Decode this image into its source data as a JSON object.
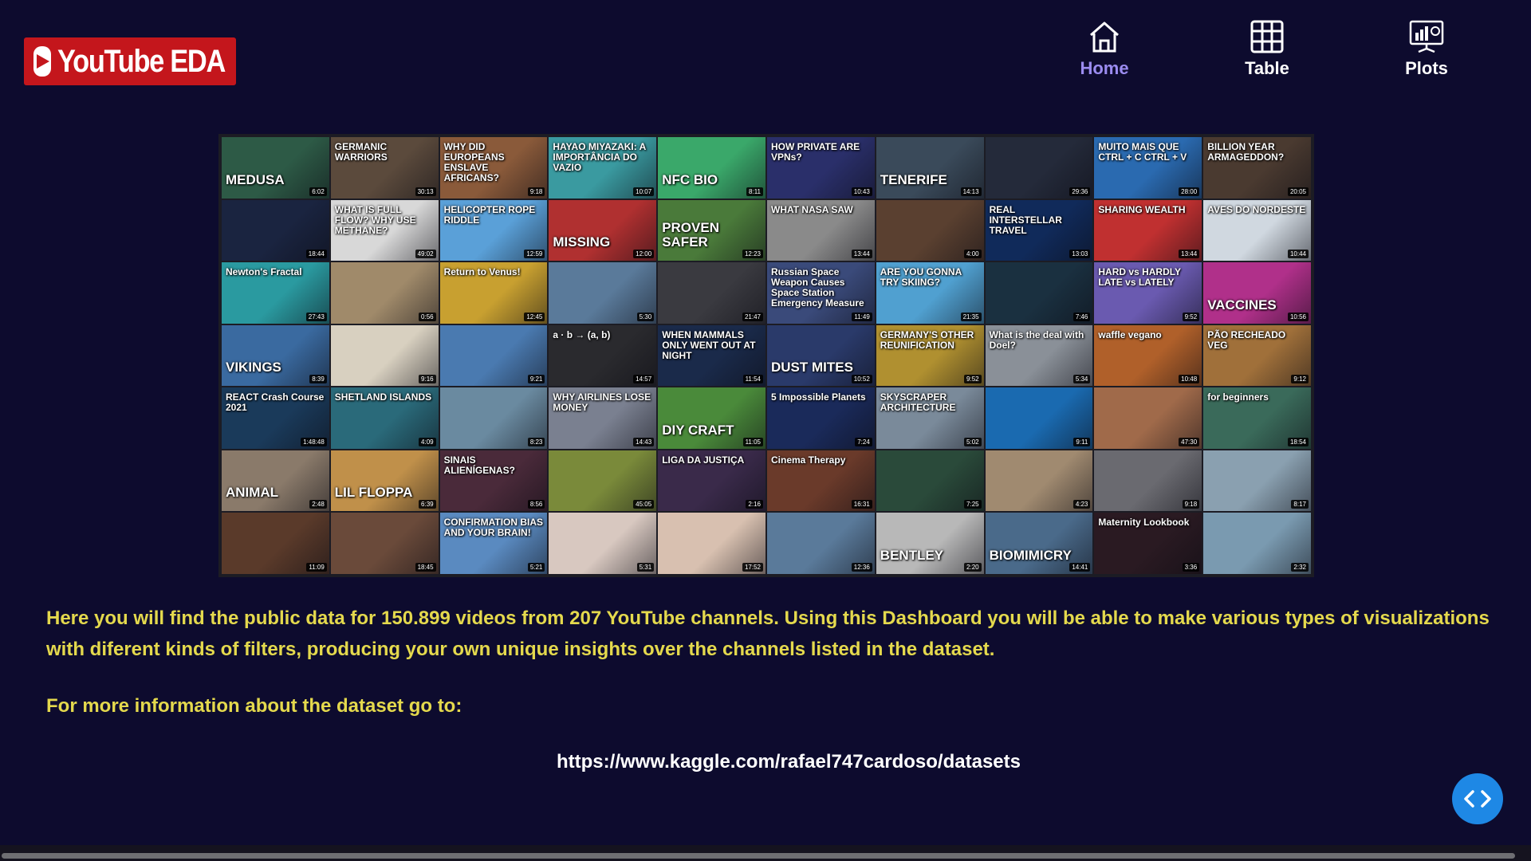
{
  "brand": {
    "name": "YouTube EDA",
    "logo_color": "#c4161c"
  },
  "nav": {
    "items": [
      {
        "label": "Home",
        "icon": "home-icon",
        "active": true
      },
      {
        "label": "Table",
        "icon": "table-icon",
        "active": false
      },
      {
        "label": "Plots",
        "icon": "plots-icon",
        "active": false
      }
    ]
  },
  "mosaic": {
    "thumbnails": [
      {
        "title": "MEDUSA",
        "duration": "6:02",
        "color": "#2d5a46"
      },
      {
        "title": "GERMANIC WARRIORS",
        "duration": "30:13",
        "color": "#5b4a3c"
      },
      {
        "title": "WHY DID EUROPEANS ENSLAVE AFRICANS?",
        "duration": "9:18",
        "color": "#8a5a3a"
      },
      {
        "title": "HAYAO MIYAZAKI: A IMPORTÂNCIA DO VAZIO",
        "duration": "10:07",
        "color": "#3a9aa0"
      },
      {
        "title": "NFC BIO",
        "duration": "8:11",
        "color": "#3aa86a"
      },
      {
        "title": "HOW PRIVATE ARE VPNs?",
        "duration": "10:43",
        "color": "#2a2f6a"
      },
      {
        "title": "TENERIFE",
        "duration": "14:13",
        "color": "#3a4a5a"
      },
      {
        "title": "",
        "duration": "29:36",
        "color": "#242a3a"
      },
      {
        "title": "MUITO MAIS QUE CTRL + C CTRL + V",
        "duration": "28:00",
        "color": "#2a6ab0"
      },
      {
        "title": "BILLION YEAR ARMAGEDDON?",
        "duration": "20:05",
        "color": "#4a3a30"
      },
      {
        "title": "",
        "duration": "18:44",
        "color": "#1a2440"
      },
      {
        "title": "WHAT IS FULL FLOW? WHY USE METHANE?",
        "duration": "49:02",
        "color": "#d8d8d8"
      },
      {
        "title": "HELICOPTER ROPE RIDDLE",
        "duration": "12:59",
        "color": "#5aa0d8"
      },
      {
        "title": "MISSING",
        "duration": "12:00",
        "color": "#b03030"
      },
      {
        "title": "PROVEN SAFER",
        "duration": "12:23",
        "color": "#4a7a3a"
      },
      {
        "title": "WHAT NASA SAW",
        "duration": "13:44",
        "color": "#8a8a8a"
      },
      {
        "title": "",
        "duration": "4:00",
        "color": "#5a4030"
      },
      {
        "title": "REAL INTERSTELLAR TRAVEL",
        "duration": "13:03",
        "color": "#102a5a"
      },
      {
        "title": "SHARING WEALTH",
        "duration": "13:44",
        "color": "#c03030"
      },
      {
        "title": "AVES DO NORDESTE",
        "duration": "10:44",
        "color": "#d0d8e0"
      },
      {
        "title": "Newton's Fractal",
        "duration": "27:43",
        "color": "#2a9aa0"
      },
      {
        "title": "",
        "duration": "0:56",
        "color": "#a08a6a"
      },
      {
        "title": "Return to Venus!",
        "duration": "12:45",
        "color": "#c8a030"
      },
      {
        "title": "",
        "duration": "5:30",
        "color": "#5a7a9a"
      },
      {
        "title": "",
        "duration": "21:47",
        "color": "#3a3a40"
      },
      {
        "title": "Russian Space Weapon Causes Space Station Emergency Measure",
        "duration": "11:49",
        "color": "#3a4a7a"
      },
      {
        "title": "ARE YOU GONNA TRY SKIING?",
        "duration": "21:35",
        "color": "#50a0d0"
      },
      {
        "title": "",
        "duration": "7:46",
        "color": "#1a3040"
      },
      {
        "title": "HARD vs HARDLY LATE vs LATELY",
        "duration": "9:52",
        "color": "#6a5ab0"
      },
      {
        "title": "VACCINES",
        "duration": "10:56",
        "color": "#b0308a"
      },
      {
        "title": "VIKINGS",
        "duration": "8:39",
        "color": "#3a6aa0"
      },
      {
        "title": "",
        "duration": "9:16",
        "color": "#d8d0c0"
      },
      {
        "title": "",
        "duration": "9:21",
        "color": "#4a7ab0"
      },
      {
        "title": "a · b → (a, b)",
        "duration": "14:57",
        "color": "#2a2a2e"
      },
      {
        "title": "WHEN MAMMALS ONLY WENT OUT AT NIGHT",
        "duration": "11:54",
        "color": "#1a2a4a"
      },
      {
        "title": "DUST MITES",
        "duration": "10:52",
        "color": "#2a3a6a"
      },
      {
        "title": "GERMANY'S OTHER REUNIFICATION",
        "duration": "9:52",
        "color": "#b09030"
      },
      {
        "title": "What is the deal with Doel?",
        "duration": "5:34",
        "color": "#8a9098"
      },
      {
        "title": "waffle vegano",
        "duration": "10:48",
        "color": "#b0602a"
      },
      {
        "title": "PÃO RECHEADO VEG",
        "duration": "9:12",
        "color": "#a0703a"
      },
      {
        "title": "REACT Crash Course 2021",
        "duration": "1:48:48",
        "color": "#1a3a5a"
      },
      {
        "title": "SHETLAND ISLANDS",
        "duration": "4:09",
        "color": "#2a6a7a"
      },
      {
        "title": "",
        "duration": "8:23",
        "color": "#6a8aa0"
      },
      {
        "title": "WHY AIRLINES LOSE MONEY",
        "duration": "14:43",
        "color": "#7a8090"
      },
      {
        "title": "DIY CRAFT",
        "duration": "11:05",
        "color": "#4a8a3a"
      },
      {
        "title": "5 Impossible Planets",
        "duration": "7:24",
        "color": "#1a2a5a"
      },
      {
        "title": "SKYSCRAPER ARCHITECTURE",
        "duration": "5:02",
        "color": "#7a8a9a"
      },
      {
        "title": "",
        "duration": "9:11",
        "color": "#1a6ab0"
      },
      {
        "title": "",
        "duration": "47:30",
        "color": "#a06a4a"
      },
      {
        "title": "for beginners",
        "duration": "18:54",
        "color": "#3a6a5a"
      },
      {
        "title": "ANIMAL",
        "duration": "2:48",
        "color": "#8a7a6a"
      },
      {
        "title": "LIL FLOPPA",
        "duration": "6:39",
        "color": "#c0904a"
      },
      {
        "title": "SINAIS ALIENÍGENAS?",
        "duration": "8:56",
        "color": "#4a2a3a"
      },
      {
        "title": "",
        "duration": "45:05",
        "color": "#7a8a3a"
      },
      {
        "title": "LIGA DA JUSTIÇA",
        "duration": "2:16",
        "color": "#3a2a4a"
      },
      {
        "title": "Cinema Therapy",
        "duration": "16:31",
        "color": "#6a3a2a"
      },
      {
        "title": "",
        "duration": "7:25",
        "color": "#2a4a3a"
      },
      {
        "title": "",
        "duration": "4:23",
        "color": "#a08a70"
      },
      {
        "title": "",
        "duration": "9:18",
        "color": "#6a6a70"
      },
      {
        "title": "",
        "duration": "8:17",
        "color": "#8aa0b0"
      },
      {
        "title": "",
        "duration": "11:09",
        "color": "#5a3a2a"
      },
      {
        "title": "",
        "duration": "18:45",
        "color": "#6a4a3a"
      },
      {
        "title": "CONFIRMATION BIAS AND YOUR BRAIN!",
        "duration": "5:21",
        "color": "#5a8ac0"
      },
      {
        "title": "",
        "duration": "5:31",
        "color": "#d8c8c0"
      },
      {
        "title": "",
        "duration": "17:52",
        "color": "#d8c0b0"
      },
      {
        "title": "",
        "duration": "12:36",
        "color": "#5a7a9a"
      },
      {
        "title": "BENTLEY",
        "duration": "2:20",
        "color": "#b8b8b8"
      },
      {
        "title": "BIOMIMICRY",
        "duration": "14:41",
        "color": "#4a6a8a"
      },
      {
        "title": "Maternity Lookbook",
        "duration": "3:36",
        "color": "#2a1a22"
      },
      {
        "title": "",
        "duration": "2:32",
        "color": "#7a9ab0"
      }
    ]
  },
  "intro": {
    "text": "Here you will find the public data for 150.899 videos from 207 YouTube channels. Using this Dashboard you will be able to make various types of visualizations with diferent kinds of filters, producing your own unique insights over the channels listed in the dataset."
  },
  "more_info": {
    "text": "For more information about the dataset go to:"
  },
  "dataset_link": {
    "url": "https://www.kaggle.com/rafael747cardoso/datasets"
  },
  "fab": {
    "icon": "code-icon",
    "color": "#1e88e5"
  },
  "colors": {
    "background": "#0d0b2e",
    "accent_text": "#e4d94d",
    "nav_active": "#9b8cf0"
  }
}
